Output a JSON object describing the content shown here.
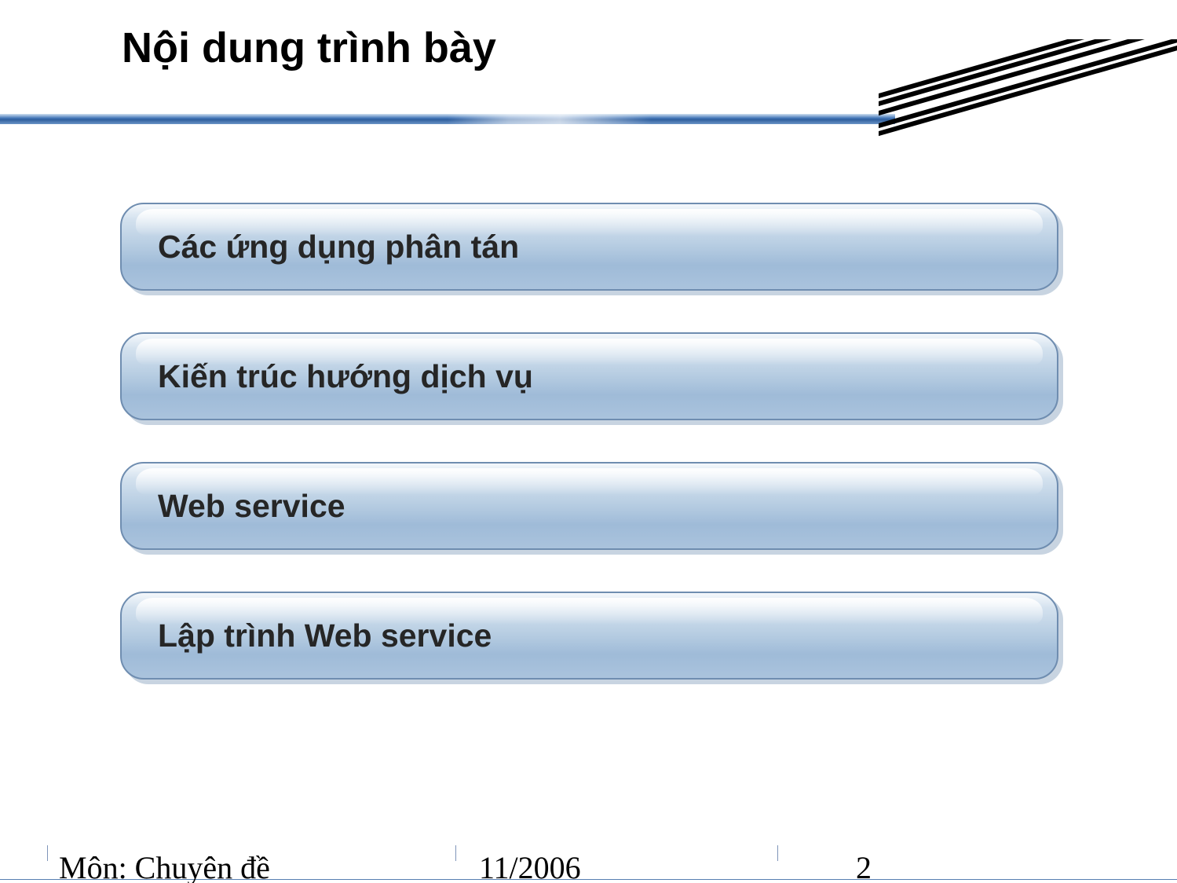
{
  "title": "Nội dung trình bày",
  "items": [
    {
      "label": "Các ứng dụng phân tán"
    },
    {
      "label": "Kiến trúc hướng dịch vụ"
    },
    {
      "label": "Web service"
    },
    {
      "label": "Lập trình Web service"
    }
  ],
  "footer": {
    "course": "Môn: Chuyên đề",
    "date": "11/2006",
    "page": "2"
  }
}
